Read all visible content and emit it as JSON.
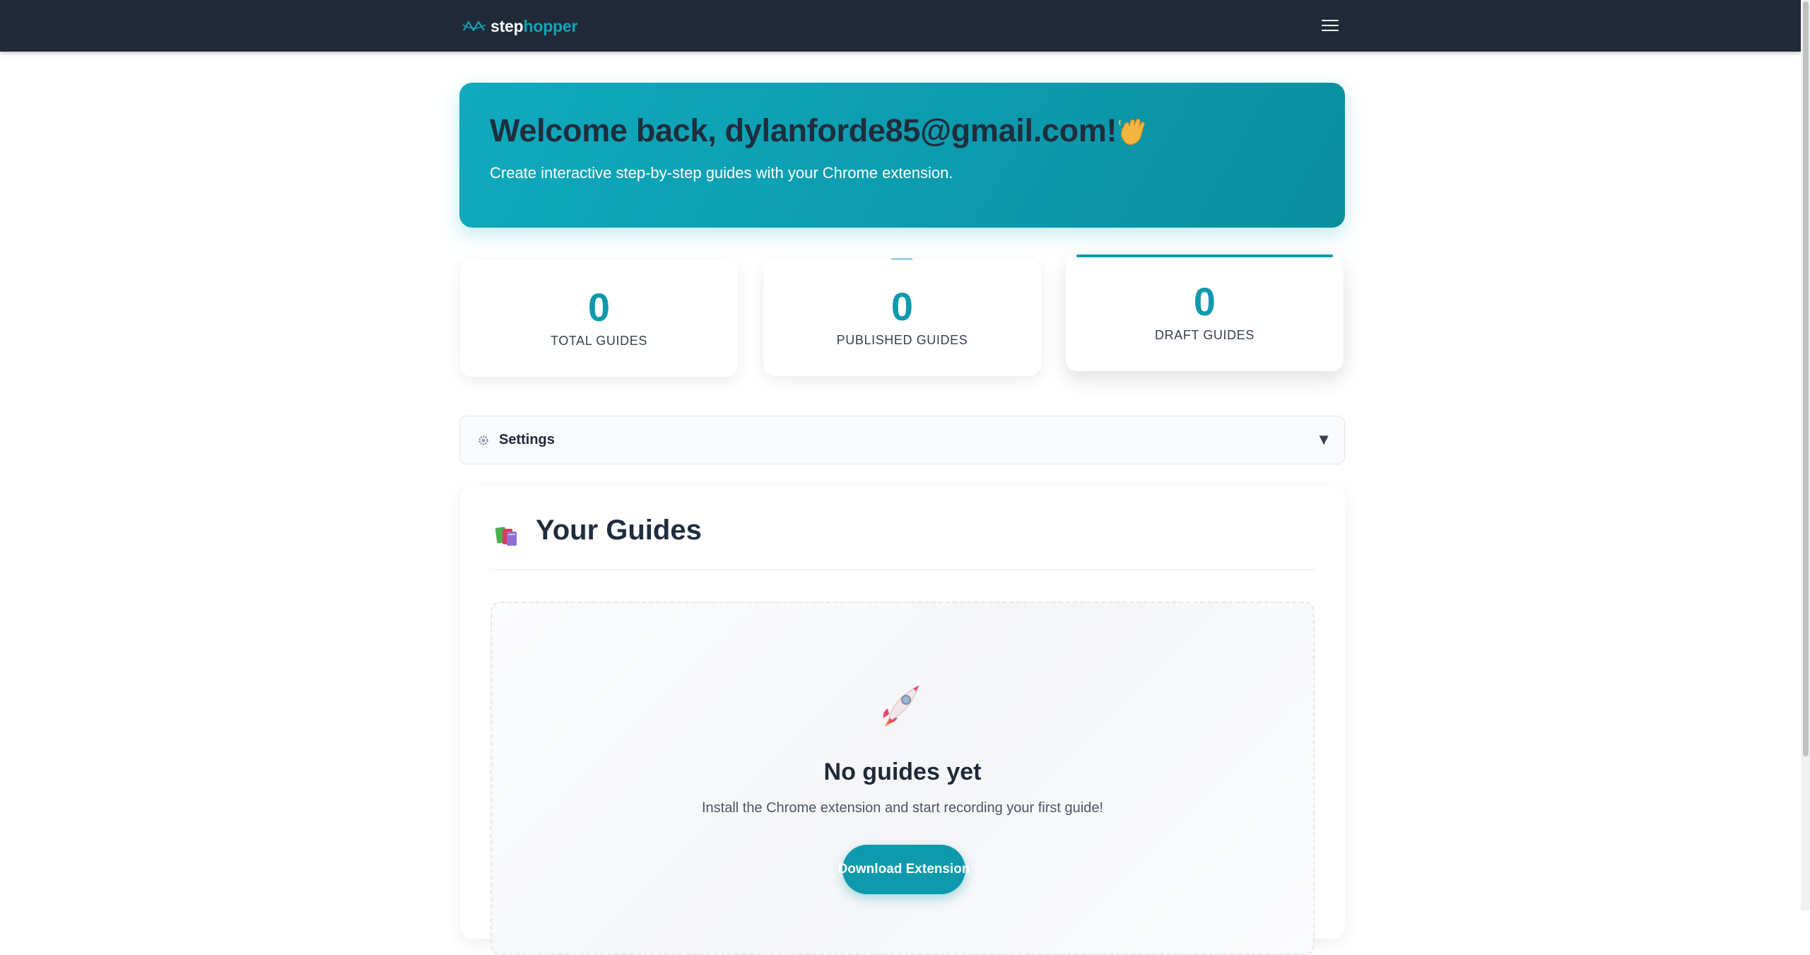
{
  "navbar": {
    "brand_step": "step",
    "brand_hopper": "hopper"
  },
  "hero": {
    "title": "Welcome back, dylanforde85@gmail.com!",
    "subtitle": "Create interactive step-by-step guides with your Chrome extension."
  },
  "stats": [
    {
      "value": "0",
      "label": "TOTAL GUIDES"
    },
    {
      "value": "0",
      "label": "PUBLISHED GUIDES"
    },
    {
      "value": "0",
      "label": "DRAFT GUIDES"
    }
  ],
  "settings": {
    "label": "Settings",
    "arrow": "▼"
  },
  "guides": {
    "title": "Your Guides",
    "empty_title": "No guides yet",
    "empty_subtitle": "Install the Chrome extension and start recording your first guide!",
    "download_label": "Download Extension"
  },
  "icons": {
    "brand": "stephopper-logo-icon",
    "menu": "hamburger-menu-icon",
    "wave": "waving-hand-icon",
    "settings": "gear-icon",
    "guides": "books-icon",
    "empty": "rocket-icon"
  },
  "colors": {
    "navbar": "#1f2937",
    "accent": "#0e9aac",
    "hero_start": "#10aabd",
    "hero_end": "#0a8f9f"
  }
}
